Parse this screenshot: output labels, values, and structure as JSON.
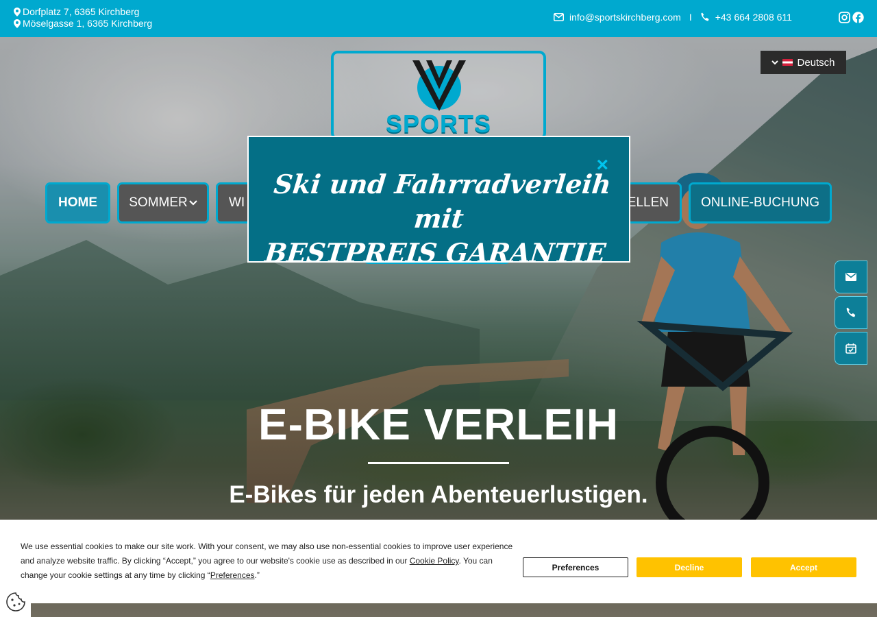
{
  "topbar": {
    "address_1": "Dorfplatz 7, 6365 Kirchberg",
    "address_2": "Möselgasse 1, 6365 Kirchberg",
    "email": "info@sportskirchberg.com",
    "separator": "I",
    "phone": "+43 664 2808 611",
    "bg_color": "#00a9cf"
  },
  "logo": {
    "word": "SPORTS"
  },
  "language": {
    "selected": "Deutsch"
  },
  "nav": {
    "home": "HOME",
    "sommer": "SOMMER",
    "winter_partial": "WI",
    "bestellen_partial": "ELLEN",
    "booking": "ONLINE-BUCHUNG"
  },
  "popup": {
    "line_1": "Ski und Fahrradverleih mit",
    "line_2": "BESTPREIS GARANTIE",
    "close": "×"
  },
  "hero": {
    "title": "E-BIKE VERLEIH",
    "subtitle": "E-Bikes für jeden Abenteuerlustigen."
  },
  "cookie": {
    "text_1": "We use essential cookies to make our site work. With your consent, we may also use non-essential cookies to improve user experience and analyze website traffic. By clicking “Accept,” you agree to our website's cookie use as described in our ",
    "policy_link": "Cookie Policy",
    "text_2": ". You can change your cookie settings at any time by clicking “",
    "preferences_link": "Preferences",
    "text_3": ".”",
    "btn_preferences": "Preferences",
    "btn_decline": "Decline",
    "btn_accept": "Accept",
    "accent_color": "#ffc200"
  },
  "icons": [
    "map-pin-icon",
    "envelope-icon",
    "phone-icon",
    "instagram-icon",
    "facebook-icon",
    "chevron-down-icon",
    "close-icon",
    "calendar-check-icon",
    "cookie-icon"
  ]
}
